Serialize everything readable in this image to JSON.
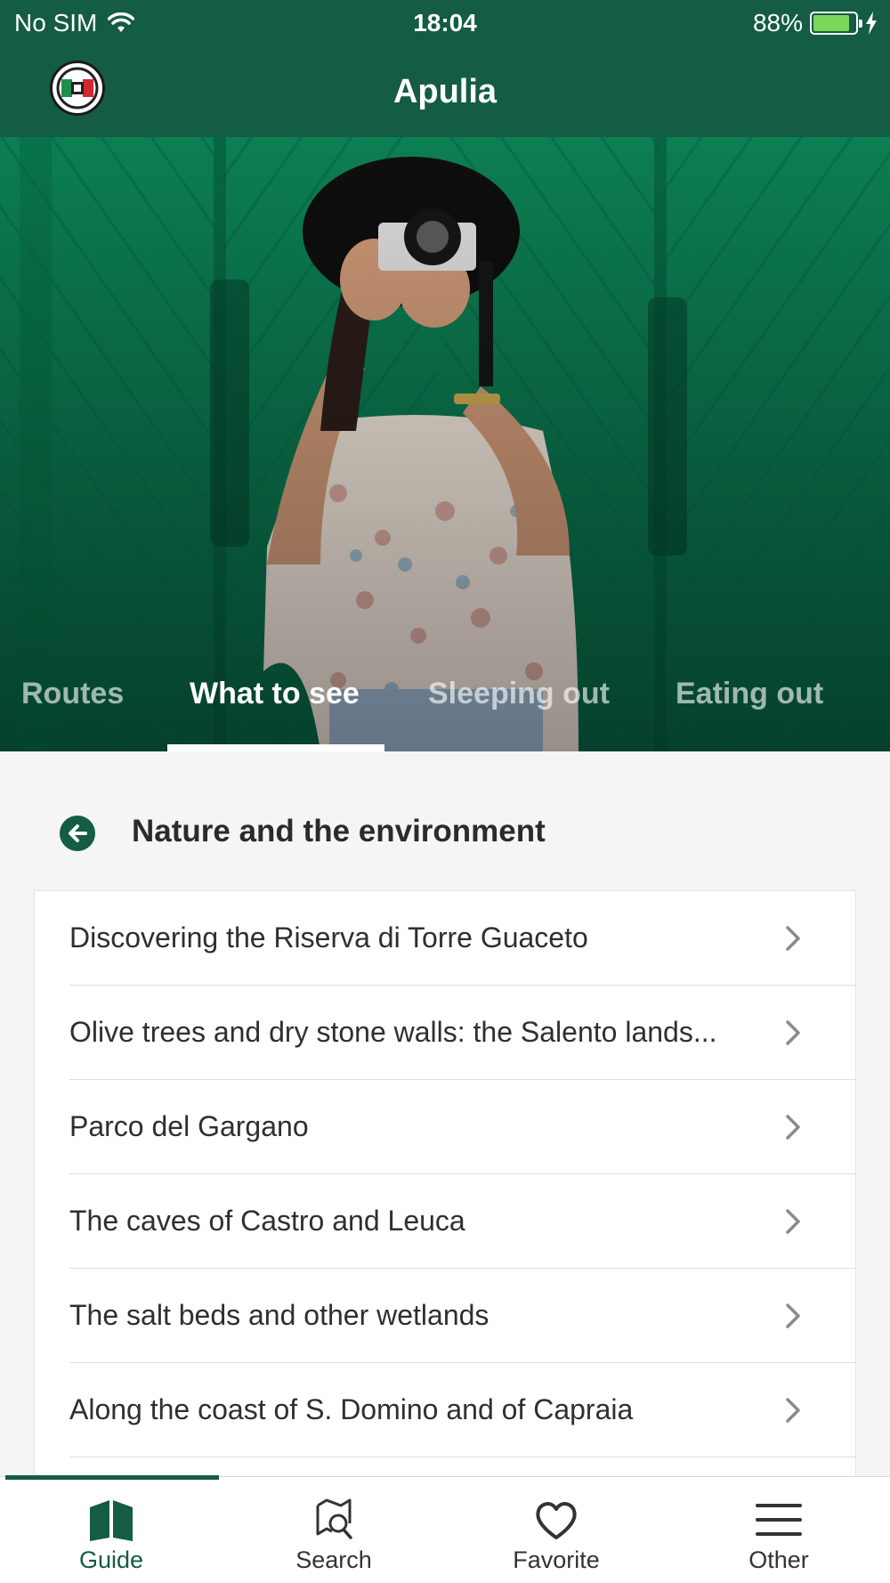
{
  "status_bar": {
    "carrier": "No SIM",
    "time": "18:04",
    "battery": "88%",
    "battery_level": 0.88
  },
  "header": {
    "title": "Apulia"
  },
  "category_tabs": [
    {
      "label": "Routes",
      "active": false
    },
    {
      "label": "What to see",
      "active": true
    },
    {
      "label": "Sleeping out",
      "active": false
    },
    {
      "label": "Eating out",
      "active": false
    }
  ],
  "section": {
    "title": "Nature and the environment"
  },
  "items": [
    {
      "label": "Discovering the Riserva di Torre Guaceto"
    },
    {
      "label": "Olive trees and dry stone walls: the Salento lands..."
    },
    {
      "label": "Parco del Gargano"
    },
    {
      "label": "The caves of Castro and Leuca"
    },
    {
      "label": "The salt beds and other wetlands"
    },
    {
      "label": "Along the coast of S. Domino and of Capraia"
    }
  ],
  "tabbar": [
    {
      "label": "Guide",
      "icon": "book-icon",
      "active": true
    },
    {
      "label": "Search",
      "icon": "map-search-icon",
      "active": false
    },
    {
      "label": "Favorite",
      "icon": "heart-icon",
      "active": false
    },
    {
      "label": "Other",
      "icon": "menu-icon",
      "active": false
    }
  ],
  "colors": {
    "brand": "#145c43",
    "hero_green": "#0f8a5a"
  }
}
